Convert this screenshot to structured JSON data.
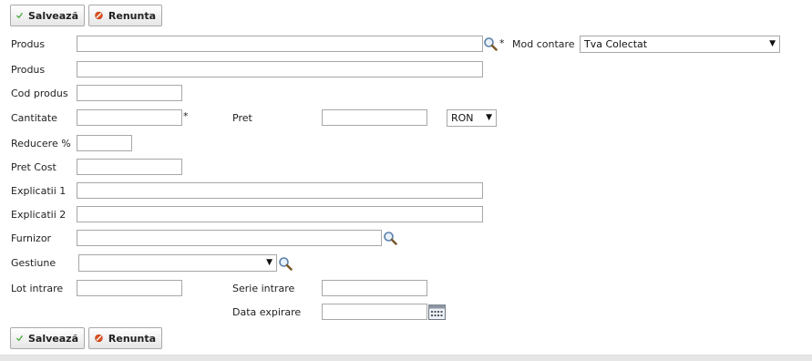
{
  "toolbar": {
    "save_label": "Salvează",
    "cancel_label": "Renunta"
  },
  "form": {
    "produs_search_label": "Produs",
    "produs_name_label": "Produs",
    "cod_produs_label": "Cod produs",
    "cantitate_label": "Cantitate",
    "pret_label": "Pret",
    "reducere_label": "Reducere %",
    "pret_cost_label": "Pret Cost",
    "explicatii1_label": "Explicatii 1",
    "explicatii2_label": "Explicatii 2",
    "furnizor_label": "Furnizor",
    "gestiune_label": "Gestiune",
    "lot_intrare_label": "Lot intrare",
    "serie_intrare_label": "Serie intrare",
    "data_expirare_label": "Data expirare",
    "mod_contare_label": "Mod contare",
    "mod_contare_value": "Tva Colectat",
    "currency_value": "RON",
    "gestiune_value": "",
    "required_mark": "*",
    "dropdown_arrow": "▼"
  },
  "icons": {
    "search": "magnifier-icon",
    "calendar": "calendar-icon",
    "save": "checkmark-icon",
    "cancel": "forbidden-icon"
  },
  "colors": {
    "accent_green": "#3fa535",
    "cancel_red": "#e0521f"
  }
}
